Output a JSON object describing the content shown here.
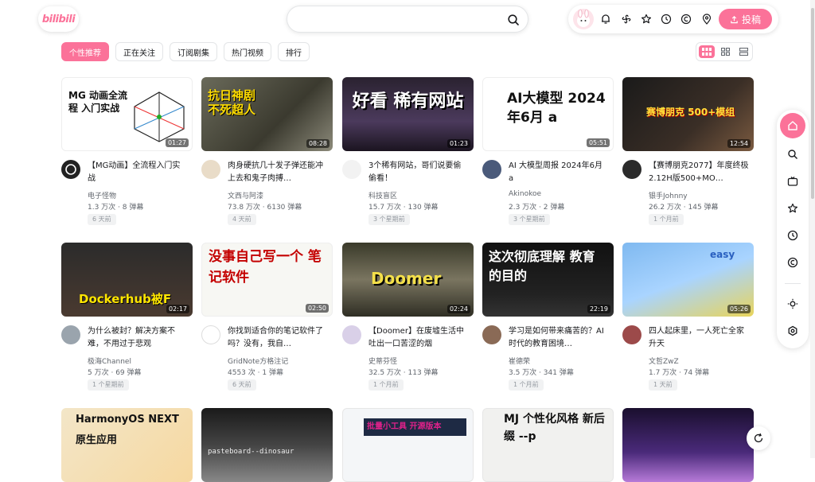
{
  "brand": {
    "logo_text": "bilibili",
    "accent": "#fb7299"
  },
  "search": {
    "placeholder": "",
    "value": ""
  },
  "header": {
    "post_label": "投稿",
    "icons": [
      "bell-icon",
      "fan-icon",
      "star-icon",
      "clock-icon",
      "bcoin-icon",
      "location-icon",
      "upload-icon"
    ]
  },
  "tabs": [
    {
      "label": "个性推荐",
      "active": true
    },
    {
      "label": "正在关注",
      "active": false
    },
    {
      "label": "订阅剧集",
      "active": false
    },
    {
      "label": "热门视频",
      "active": false
    },
    {
      "label": "排行",
      "active": false
    }
  ],
  "layout_switch": [
    "grid-3x-icon",
    "grid-2x-icon",
    "list-icon"
  ],
  "videos": [
    {
      "thumb_text": "MG 动画全流程 入门实战",
      "duration": "01:27",
      "title": "【MG动画】全流程入门实战",
      "uploader": "电子怪物",
      "views": "1.3 万次",
      "danmaku": "8 弹幕",
      "age": "6 天前"
    },
    {
      "thumb_text": "抗日神剧 不死超人",
      "duration": "08:28",
      "title": "肉身硬抗几十发子弹还能冲上去和鬼子肉搏…",
      "uploader": "文西与阿漆",
      "views": "73.8 万次",
      "danmaku": "6130 弹幕",
      "age": "4 天前"
    },
    {
      "thumb_text": "好看 稀有网站",
      "duration": "01:23",
      "title": "3个稀有网站，哥们说要偷偷看！",
      "uploader": "科技盲区",
      "views": "15.7 万次",
      "danmaku": "130 弹幕",
      "age": "3 个星期前"
    },
    {
      "thumb_text": "AI大模型 2024年6月 a",
      "duration": "05:51",
      "title": "AI 大模型周报 2024年6月 a",
      "uploader": "Akinokoe",
      "views": "2.3 万次",
      "danmaku": "2 弹幕",
      "age": "3 个星期前"
    },
    {
      "thumb_text": "赛博朋克 500+模组",
      "duration": "12:54",
      "title": "【赛博朋克2077】年度终极2.12H版500+MO…",
      "uploader": "银手Johnny",
      "views": "26.2 万次",
      "danmaku": "145 弹幕",
      "age": "1 个月前"
    },
    {
      "thumb_text": "Dockerhub被F",
      "duration": "02:17",
      "title": "为什么被封？解决方案不难，不用过于悲观",
      "uploader": "极海Channel",
      "views": "5 万次",
      "danmaku": "69 弹幕",
      "age": "1 个星期前"
    },
    {
      "thumb_text": "没事自己写一个 笔记软件",
      "duration": "02:50",
      "title": "你找到适合你的笔记软件了吗？没有，我自…",
      "uploader": "GridNote方格注记",
      "views": "4553 次",
      "danmaku": "1 弹幕",
      "age": "6 天前"
    },
    {
      "thumb_text": "Doomer",
      "duration": "02:24",
      "title": "【Doomer】在废墟生活中吐出一口苦涩的烟",
      "uploader": "史蒂芬怪",
      "views": "32.5 万次",
      "danmaku": "113 弹幕",
      "age": "1 个月前"
    },
    {
      "thumb_text": "这次彻底理解 教育的目的",
      "duration": "22:19",
      "title": "学习是如何带来痛苦的？AI时代的教育困境…",
      "uploader": "崔德荣",
      "views": "3.5 万次",
      "danmaku": "341 弹幕",
      "age": "1 个月前"
    },
    {
      "thumb_text": "easy",
      "duration": "05:26",
      "title": "四人起床里，一人死亡全家升天",
      "uploader": "文哲ZwZ",
      "views": "1.7 万次",
      "danmaku": "74 弹幕",
      "age": "1 天前"
    },
    {
      "thumb_text": "HarmonyOS NEXT 原生应用",
      "duration": "",
      "title": "",
      "uploader": "",
      "views": "",
      "danmaku": "",
      "age": ""
    },
    {
      "thumb_text": "pasteboard--dinosaur",
      "duration": "",
      "title": "",
      "uploader": "",
      "views": "",
      "danmaku": "",
      "age": ""
    },
    {
      "thumb_text": "批量小工具 开源版本",
      "duration": "",
      "title": "",
      "uploader": "",
      "views": "",
      "danmaku": "",
      "age": ""
    },
    {
      "thumb_text": "MJ 个性化风格 新后缀 --p",
      "duration": "",
      "title": "",
      "uploader": "",
      "views": "",
      "danmaku": "",
      "age": ""
    },
    {
      "thumb_text": "",
      "duration": "",
      "title": "",
      "uploader": "",
      "views": "",
      "danmaku": "",
      "age": ""
    }
  ],
  "sidebar": [
    "home-icon",
    "search-icon",
    "tv-icon",
    "star-icon",
    "clock-icon",
    "bcoin-icon",
    "sun-icon",
    "settings-icon"
  ],
  "refresh_icon": "refresh-icon"
}
